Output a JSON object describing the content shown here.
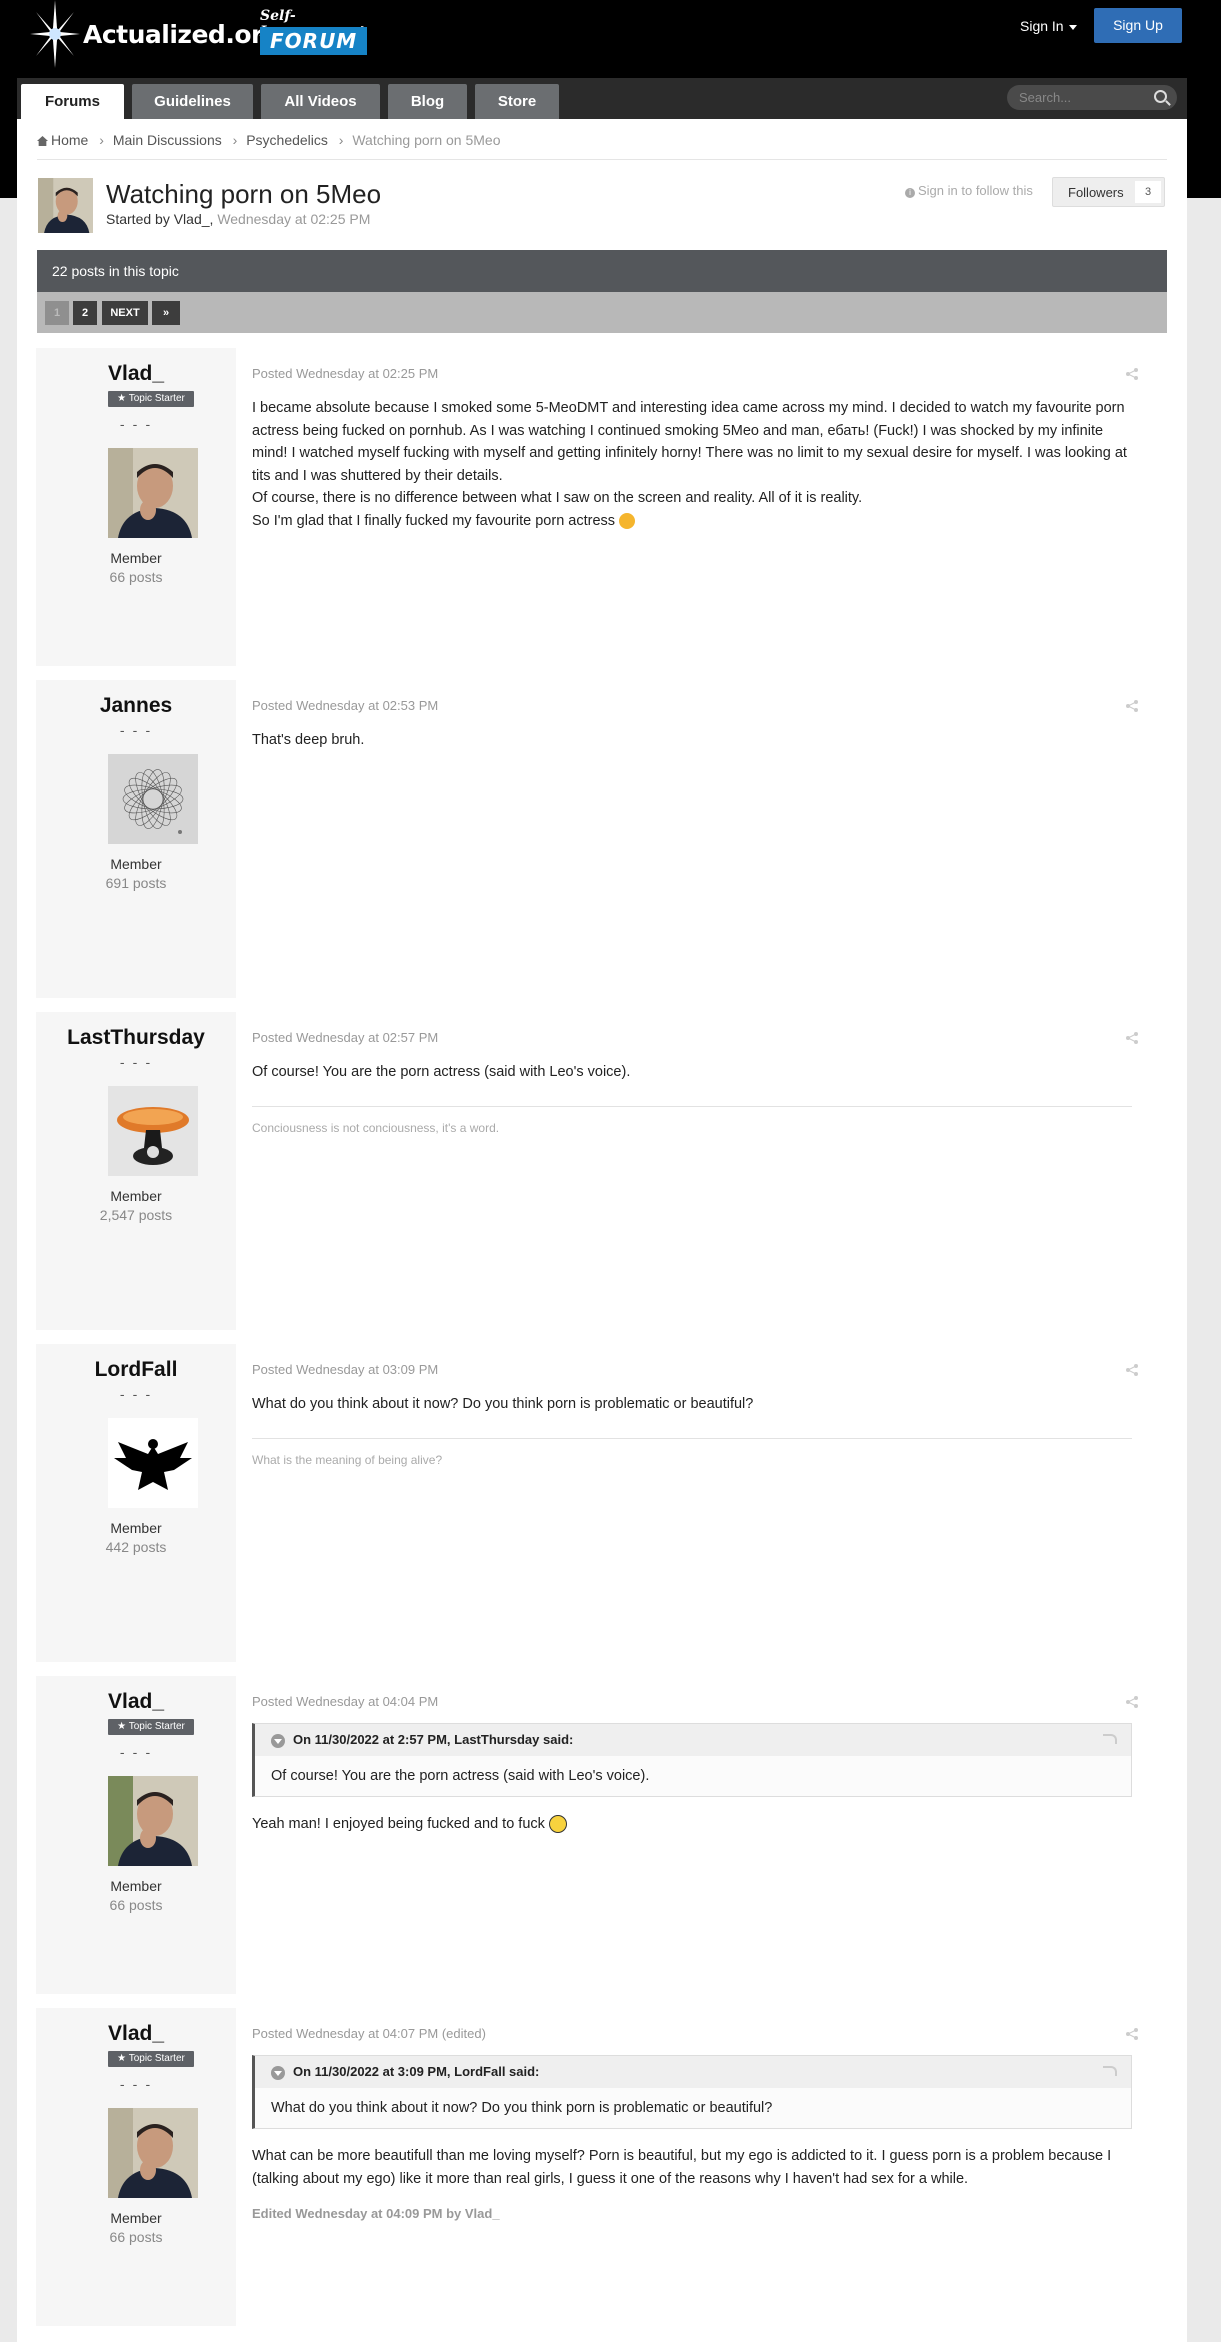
{
  "header": {
    "brand": "Actualized.org",
    "tagline": "Self-Improvement",
    "forum_badge": "FORUM",
    "sign_in": "Sign In",
    "sign_up": "Sign Up"
  },
  "nav": {
    "tabs": [
      "Forums",
      "Guidelines",
      "All Videos",
      "Blog",
      "Store"
    ],
    "search_placeholder": "Search..."
  },
  "breadcrumb": [
    "Home",
    "Main Discussions",
    "Psychedelics",
    "Watching porn on 5Meo"
  ],
  "topic": {
    "title": "Watching porn on 5Meo",
    "started_by_prefix": "Started by",
    "author": "Vlad_,",
    "date": "Wednesday at 02:25 PM",
    "follow_text": "Sign in to follow this",
    "followers_label": "Followers",
    "followers_count": "3",
    "posts_count_text": "22 posts in this topic"
  },
  "pagination": {
    "pages": [
      "1",
      "2"
    ],
    "next": "NEXT",
    "last": "»"
  },
  "posts": [
    {
      "author": "Vlad_",
      "badge": "★ Topic Starter",
      "dashes": "- - -",
      "rank": "Member",
      "post_count": "66 posts",
      "posted": "Posted Wednesday at 02:25 PM",
      "paragraphs": [
        "I became absolute because I smoked some 5-MeoDMT and interesting idea came across my mind. I decided to watch my favourite porn actress being fucked on pornhub. As I was watching I continued smoking 5Meo and man, ебать! (Fuck!) I was shocked by my infinite mind! I watched myself fucking with myself and getting infinitely horny! There was no limit to my sexual desire for myself. I was looking at tits and I was shuttered by their details.",
        "Of course, there is no difference between what I saw on the screen and reality. All of it is reality.",
        "So I'm glad that I finally fucked my favourite porn actress"
      ]
    },
    {
      "author": "Jannes",
      "dashes": "- - -",
      "rank": "Member",
      "post_count": "691 posts",
      "posted": "Posted Wednesday at 02:53 PM",
      "paragraphs": [
        "That's deep bruh."
      ]
    },
    {
      "author": "LastThursday",
      "dashes": "- - -",
      "rank": "Member",
      "post_count": "2,547 posts",
      "posted": "Posted Wednesday at 02:57 PM",
      "paragraphs": [
        "Of course! You are the porn actress (said with Leo's voice)."
      ],
      "signature": "Conciousness is not conciousness, it's a word."
    },
    {
      "author": "LordFall",
      "dashes": "- - -",
      "rank": "Member",
      "post_count": "442 posts",
      "posted": "Posted Wednesday at 03:09 PM",
      "paragraphs": [
        "What do you think about it now? Do you think porn is problematic or beautiful?"
      ],
      "signature": "What is the meaning of being alive?"
    },
    {
      "author": "Vlad_",
      "badge": "★ Topic Starter",
      "dashes": "- - -",
      "rank": "Member",
      "post_count": "66 posts",
      "posted": "Posted Wednesday at 04:04 PM",
      "quote_head": "On 11/30/2022 at 2:57 PM, LastThursday said:",
      "quote_body": "Of course! You are the porn actress (said with Leo's voice).",
      "paragraphs": [
        "Yeah man! I enjoyed being fucked and to fuck"
      ]
    },
    {
      "author": "Vlad_",
      "badge": "★ Topic Starter",
      "dashes": "- - -",
      "rank": "Member",
      "post_count": "66 posts",
      "posted": "Posted Wednesday at 04:07 PM (edited)",
      "quote_head": "On 11/30/2022 at 3:09 PM, LordFall said:",
      "quote_body": "What do you think about it now? Do you think porn is problematic or beautiful?",
      "paragraphs": [
        "What can be more beautifull than me loving myself? Porn is beautiful, but my ego is addicted to it.  I guess porn is a problem because I (talking about my ego) like it more than real girls, I guess it one of the reasons why I haven't had sex for a while."
      ],
      "edited": "Edited Wednesday at 04:09 PM by Vlad_"
    }
  ]
}
